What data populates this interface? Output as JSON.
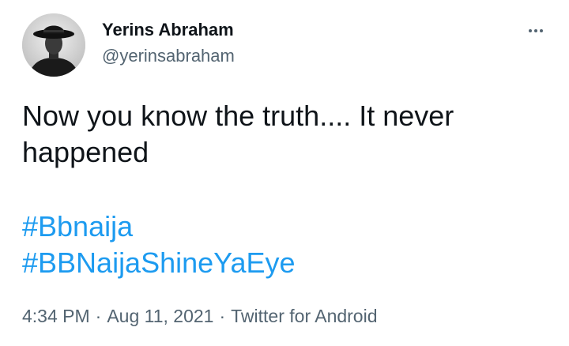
{
  "author": {
    "display_name": "Yerins Abraham",
    "handle": "@yerinsabraham",
    "avatar_icon": "profile-photo-man-in-hat"
  },
  "more_icon": "more-horizontal-icon",
  "tweet": {
    "text_lines": [
      "Now you know the truth.... It never",
      "happened"
    ],
    "hashtags": [
      "#Bbnaija",
      "#BBNaijaShineYaEye"
    ]
  },
  "meta": {
    "time": "4:34 PM",
    "separator": "·",
    "date": "Aug 11, 2021",
    "source": "Twitter for Android"
  },
  "colors": {
    "text": "#0f1419",
    "secondary": "#536471",
    "link": "#1d9bf0"
  }
}
